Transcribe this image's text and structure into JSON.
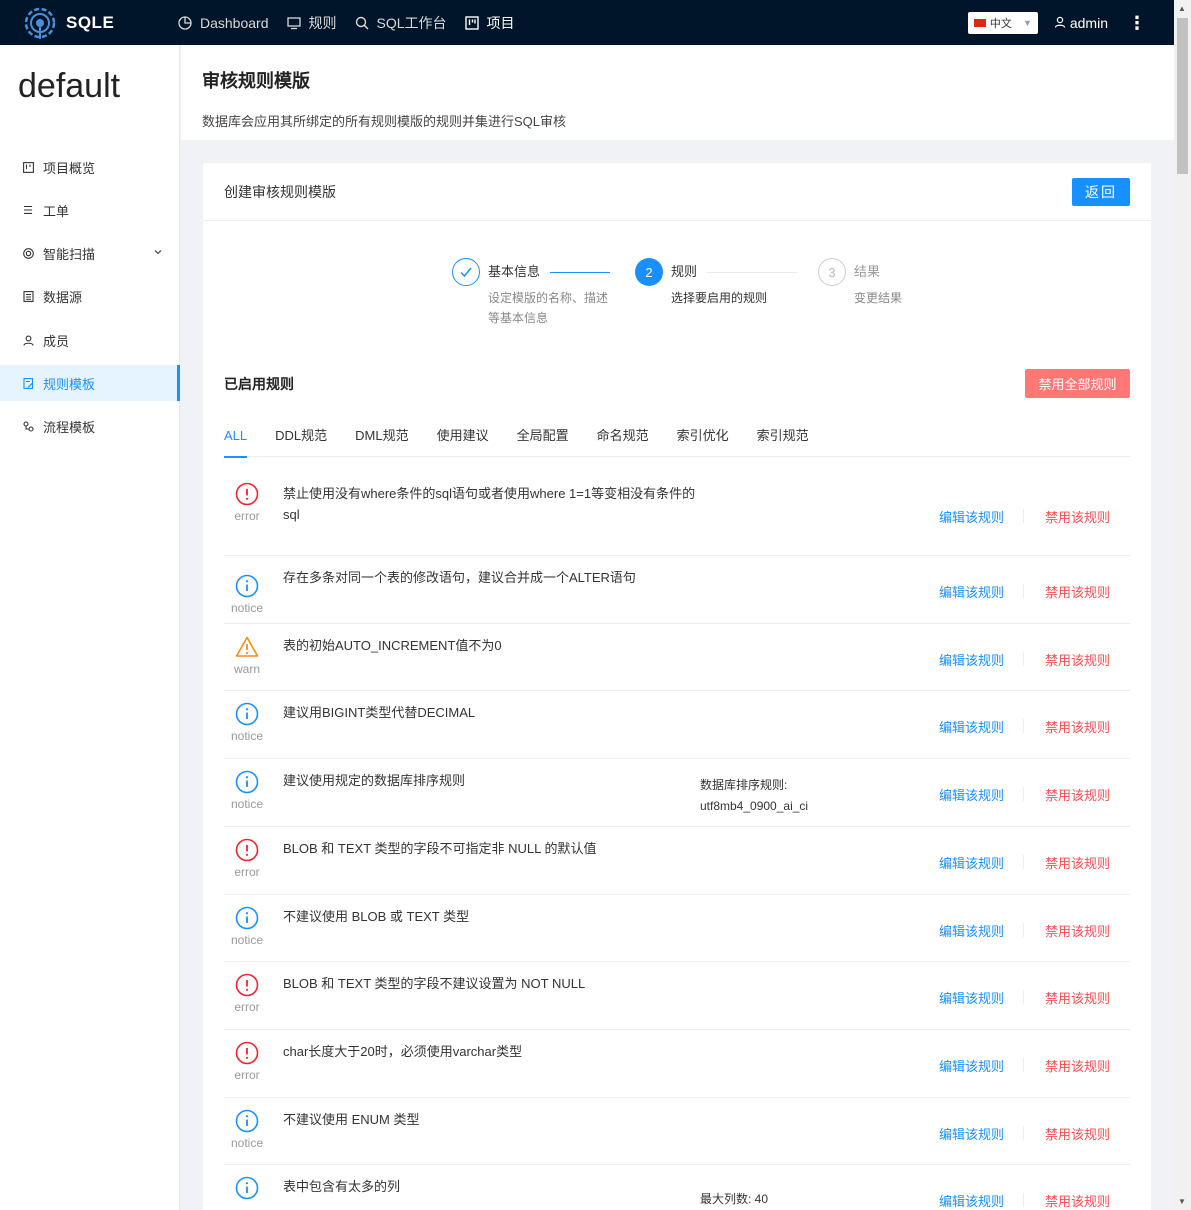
{
  "app": {
    "name": "SQLE"
  },
  "topnav": {
    "items": [
      {
        "label": "Dashboard",
        "icon": "pie-chart-icon"
      },
      {
        "label": "规则",
        "icon": "desktop-icon"
      },
      {
        "label": "SQL工作台",
        "icon": "search-icon"
      },
      {
        "label": "项目",
        "icon": "project-icon"
      }
    ],
    "language": "中文",
    "user": "admin"
  },
  "sidebar": {
    "project": "default",
    "items": [
      {
        "label": "项目概览",
        "icon": "project-icon"
      },
      {
        "label": "工单",
        "icon": "list-icon"
      },
      {
        "label": "智能扫描",
        "icon": "scan-icon"
      },
      {
        "label": "数据源",
        "icon": "database-icon"
      },
      {
        "label": "成员",
        "icon": "user-icon"
      },
      {
        "label": "规则模板",
        "icon": "template-icon"
      },
      {
        "label": "流程模板",
        "icon": "flow-icon"
      }
    ]
  },
  "page": {
    "title": "审核规则模版",
    "description": "数据库会应用其所绑定的所有规则模版的规则并集进行SQL审核"
  },
  "card": {
    "title": "创建审核规则模版",
    "back_label": "返回"
  },
  "steps": [
    {
      "num": "1",
      "title": "基本信息",
      "desc1": "设定模版的名称、描述",
      "desc2": "等基本信息",
      "status": "done"
    },
    {
      "num": "2",
      "title": "规则",
      "desc1": "选择要启用的规则",
      "desc2": "",
      "status": "current"
    },
    {
      "num": "3",
      "title": "结果",
      "desc1": "变更结果",
      "desc2": "",
      "status": "wait"
    }
  ],
  "rules": {
    "title": "已启用规则",
    "disable_all_label": "禁用全部规则",
    "tabs": [
      "ALL",
      "DDL规范",
      "DML规范",
      "使用建议",
      "全局配置",
      "命名规范",
      "索引优化",
      "索引规范"
    ],
    "edit_label": "编辑该规则",
    "disable_label": "禁用该规则",
    "items": [
      {
        "level": "error",
        "desc": "禁止使用没有where条件的sql语句或者使用where 1=1等变相没有条件的sql",
        "param1": "",
        "param2": ""
      },
      {
        "level": "notice",
        "desc": "存在多条对同一个表的修改语句，建议合并成一个ALTER语句",
        "param1": "",
        "param2": ""
      },
      {
        "level": "warn",
        "desc": "表的初始AUTO_INCREMENT值不为0",
        "param1": "",
        "param2": ""
      },
      {
        "level": "notice",
        "desc": "建议用BIGINT类型代替DECIMAL",
        "param1": "",
        "param2": ""
      },
      {
        "level": "notice",
        "desc": "建议使用规定的数据库排序规则",
        "param1": "数据库排序规则:",
        "param2": "utf8mb4_0900_ai_ci"
      },
      {
        "level": "error",
        "desc": "BLOB 和 TEXT 类型的字段不可指定非 NULL 的默认值",
        "param1": "",
        "param2": ""
      },
      {
        "level": "notice",
        "desc": "不建议使用 BLOB 或 TEXT 类型",
        "param1": "",
        "param2": ""
      },
      {
        "level": "error",
        "desc": "BLOB 和 TEXT 类型的字段不建议设置为 NOT NULL",
        "param1": "",
        "param2": ""
      },
      {
        "level": "error",
        "desc": "char长度大于20时，必须使用varchar类型",
        "param1": "",
        "param2": ""
      },
      {
        "level": "notice",
        "desc": "不建议使用 ENUM 类型",
        "param1": "",
        "param2": ""
      },
      {
        "level": "notice",
        "desc": "表中包含有太多的列",
        "param1": "",
        "param2": "最大列数: 40"
      }
    ]
  },
  "colors": {
    "primary": "#1890ff",
    "danger": "#ff4d4f",
    "warn": "#fa8c16",
    "nav": "#001529"
  }
}
